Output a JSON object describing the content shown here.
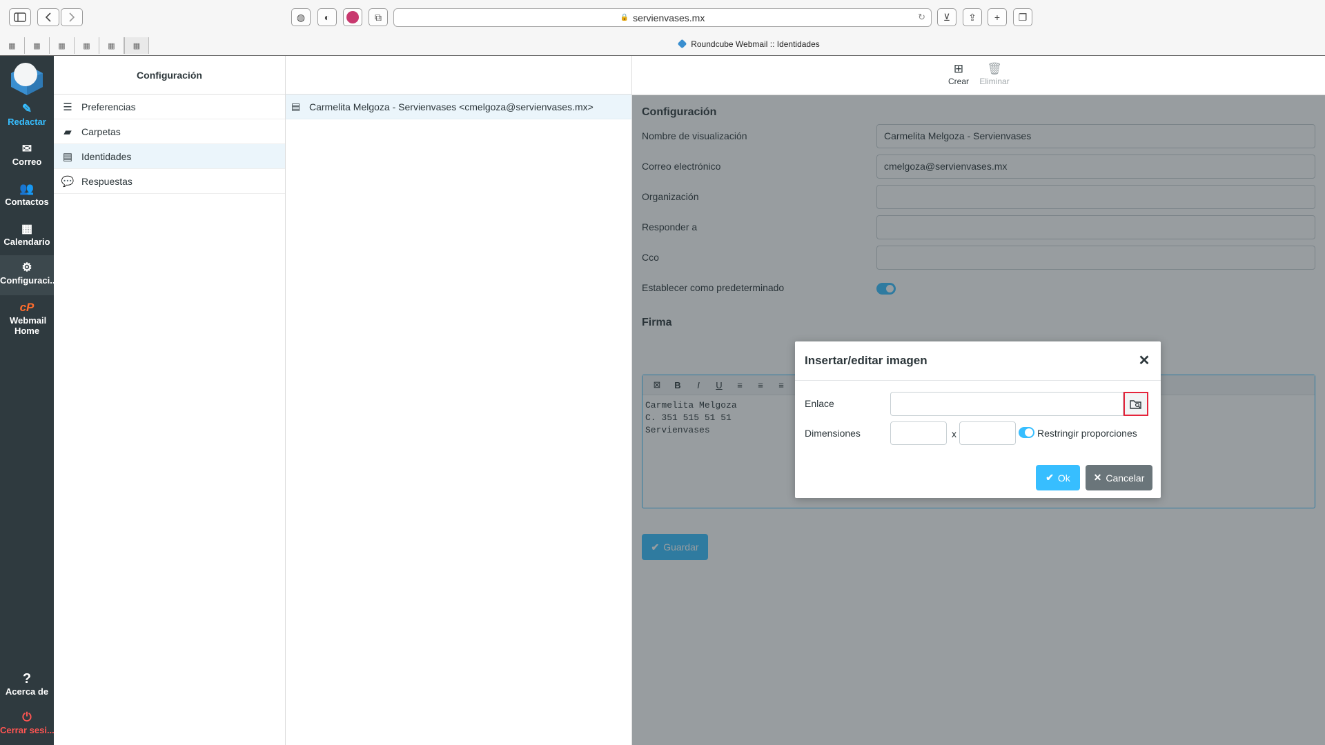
{
  "browser": {
    "url": "servienvases.mx",
    "tab_title": "Roundcube Webmail :: Identidades",
    "mini_tab_glyph": "▦"
  },
  "nav": {
    "items": [
      {
        "label": "Redactar",
        "icon": "compose-icon",
        "glyph": "✎"
      },
      {
        "label": "Correo",
        "icon": "mail-icon",
        "glyph": "✉"
      },
      {
        "label": "Contactos",
        "icon": "contacts-icon",
        "glyph": "👥"
      },
      {
        "label": "Calendario",
        "icon": "calendar-icon",
        "glyph": "▦"
      },
      {
        "label": "Configuraci...",
        "icon": "gear-icon",
        "glyph": "⚙"
      },
      {
        "label": "Webmail Home",
        "icon": "cpanel-icon",
        "glyph": "cP"
      }
    ],
    "about": {
      "label": "Acerca de",
      "glyph": "?"
    },
    "logout": {
      "label": "Cerrar sesi...",
      "glyph": "⏻"
    }
  },
  "settings": {
    "header": "Configuración",
    "items": [
      {
        "label": "Preferencias",
        "glyph": "☰"
      },
      {
        "label": "Carpetas",
        "glyph": "▰"
      },
      {
        "label": "Identidades",
        "glyph": "▤"
      },
      {
        "label": "Respuestas",
        "glyph": "💬"
      }
    ]
  },
  "identities": {
    "rows": [
      {
        "label": "Carmelita Melgoza - Servienvases <cmelgoza@servienvases.mx>",
        "glyph": "▤"
      }
    ]
  },
  "toolbar": {
    "create": {
      "label": "Crear",
      "glyph": "⊞"
    },
    "delete": {
      "label": "Eliminar",
      "glyph": "🗑"
    }
  },
  "form": {
    "section_title": "Configuración",
    "fields": [
      {
        "label": "Nombre de visualización",
        "value": "Carmelita Melgoza - Servienvases"
      },
      {
        "label": "Correo electrónico",
        "value": "cmelgoza@servienvases.mx"
      },
      {
        "label": "Organización",
        "value": ""
      },
      {
        "label": "Responder a",
        "value": ""
      },
      {
        "label": "Cco",
        "value": ""
      }
    ],
    "default_label": "Establecer como predeterminado",
    "default_on": true,
    "signature_title": "Firma",
    "editor_buttons": [
      {
        "name": "clear-format-icon",
        "glyph": "⊠"
      },
      {
        "name": "bold-icon",
        "glyph": "B"
      },
      {
        "name": "italic-icon",
        "glyph": "I"
      },
      {
        "name": "underline-icon",
        "glyph": "U"
      },
      {
        "name": "align-left-icon",
        "glyph": "≡"
      },
      {
        "name": "align-center-icon",
        "glyph": "≡"
      },
      {
        "name": "align-right-icon",
        "glyph": "≡"
      }
    ],
    "signature_lines": [
      "Carmelita Melgoza",
      "C. 351 515 51 51",
      "Servienvases"
    ],
    "save_label": "Guardar"
  },
  "dialog": {
    "title": "Insertar/editar imagen",
    "link_label": "Enlace",
    "link_value": "",
    "dimensions_label": "Dimensiones",
    "width_value": "",
    "height_value": "",
    "dim_separator": "x",
    "constrain_label": "Restringir proporciones",
    "constrain_on": true,
    "ok_label": "Ok",
    "cancel_label": "Cancelar",
    "close_glyph": "✕"
  },
  "colors": {
    "accent": "#37beff",
    "nav_bg": "#2f3a3f",
    "highlight_border": "#e5243b",
    "cancel_bg": "#6a757a"
  }
}
